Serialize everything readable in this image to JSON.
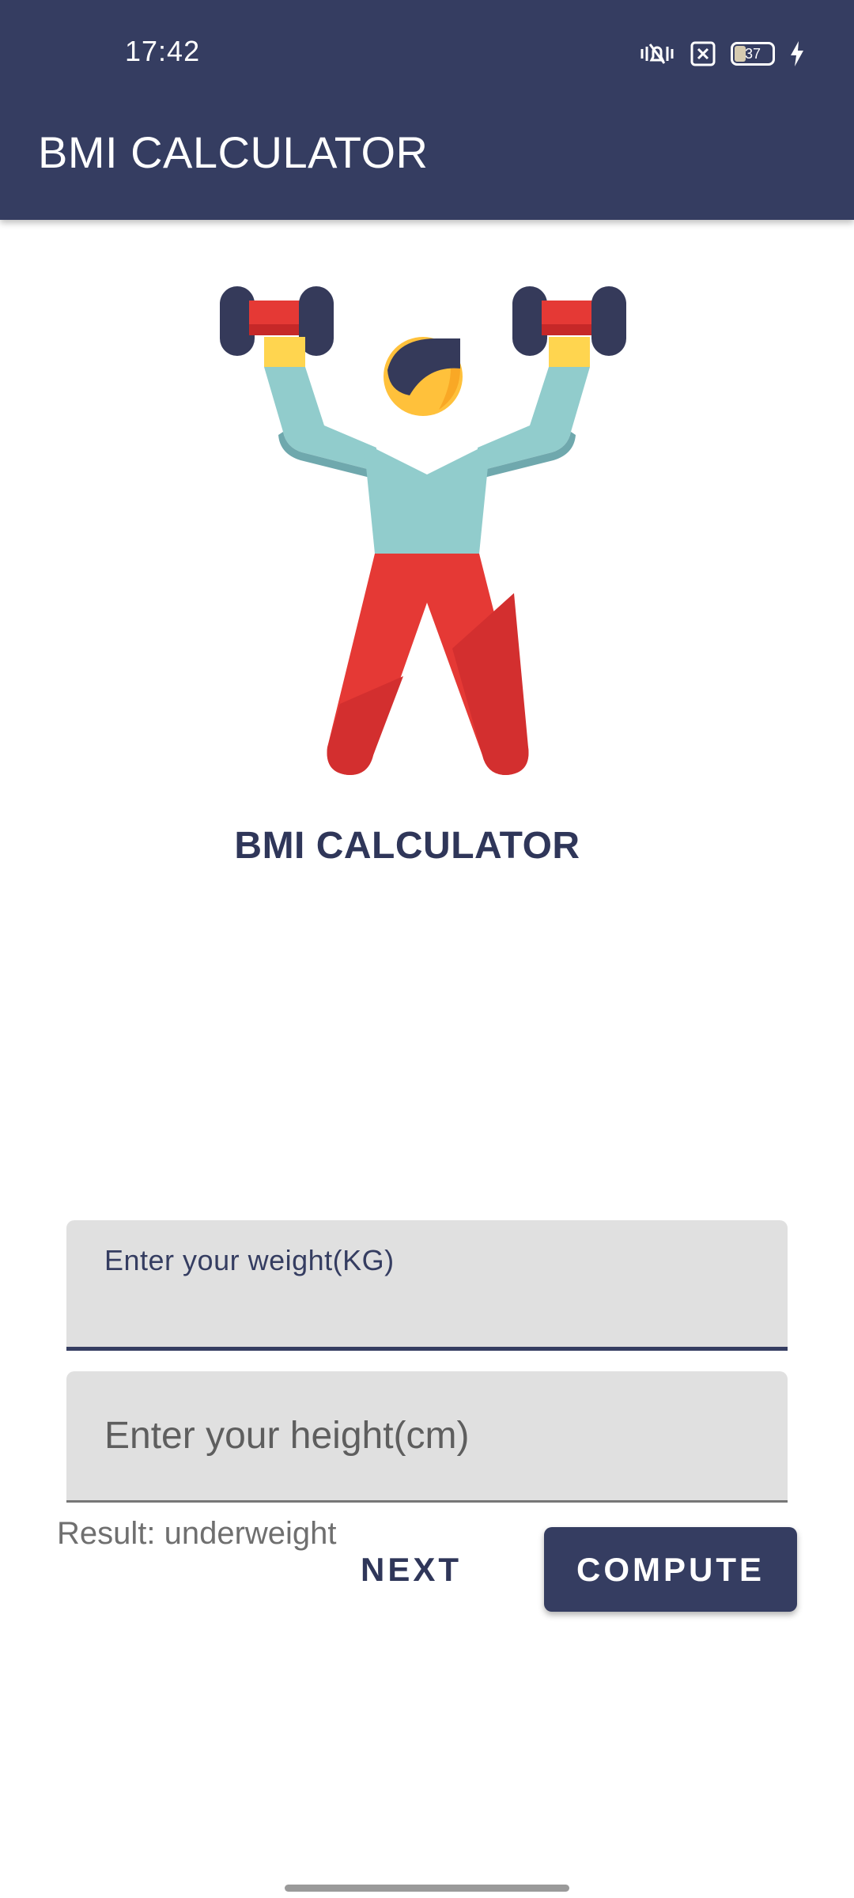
{
  "status_bar": {
    "time": "17:42",
    "battery_level": "37",
    "icons": [
      "vibrate-icon",
      "notification-off-icon",
      "battery-icon",
      "charging-icon"
    ]
  },
  "app_bar": {
    "title": "BMI CALCULATOR"
  },
  "hero": {
    "illustration": "weightlifter-icon",
    "title": "BMI CALCULATOR"
  },
  "form": {
    "weight": {
      "label": "Enter your weight(KG)",
      "value": ""
    },
    "height": {
      "placeholder": "Enter your height(cm)",
      "value": ""
    }
  },
  "result": {
    "text": "Result: underweight"
  },
  "actions": {
    "next_label": "NEXT",
    "compute_label": "COMPUTE"
  },
  "colors": {
    "primary": "#353d61",
    "field_bg": "#e0e0e0",
    "accent_red": "#e53935",
    "accent_teal": "#91cccc",
    "accent_yellow": "#ffd54f"
  }
}
